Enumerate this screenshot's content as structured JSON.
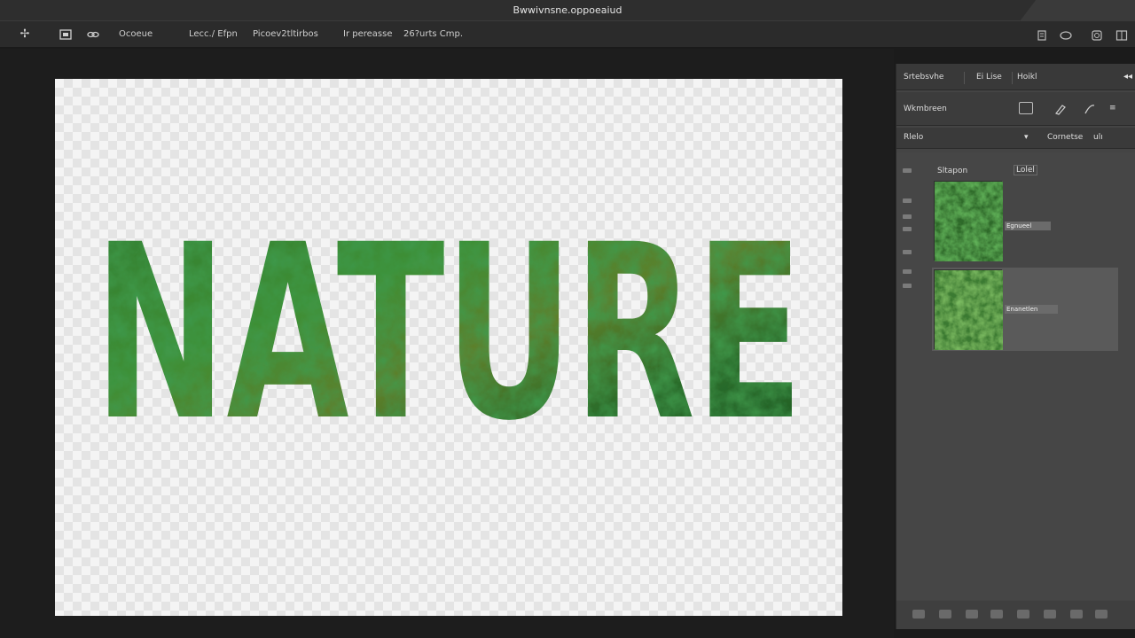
{
  "window": {
    "title": "Bwwivnsne.oppoeaiud"
  },
  "menu": {
    "items": [
      "Ocoeue",
      "Lecc./ Efpn",
      "Picoev2tltirbos",
      "Ir pereasse",
      "26?urts Cmp."
    ],
    "tool_icons": [
      "move-icon",
      "image-icon",
      "link-icon"
    ],
    "right_icons": [
      "document-icon",
      "speech-icon",
      "search-icon",
      "panels-icon"
    ]
  },
  "canvas": {
    "artwork_text": "NATURE",
    "artwork_colors": {
      "dark_green": "#1f5e24",
      "mid_green": "#3a8a35",
      "olive": "#6f8a2e"
    }
  },
  "panel": {
    "tabs": [
      "Srtebsvhe",
      "Ei Lise",
      "Hoikl"
    ],
    "collapse_icon": "double-chevron-left-icon",
    "row1_label": "Wkmbreen",
    "row2_label": "Rlelo",
    "row2_right": "Cornetse",
    "row2_right_value": "ulı",
    "layers_header": {
      "name": "Sltapon",
      "lock": "Lolel"
    },
    "layers": [
      {
        "name": "Egnueel",
        "selected": false
      },
      {
        "name": "Enanetlen",
        "selected": true
      }
    ]
  }
}
